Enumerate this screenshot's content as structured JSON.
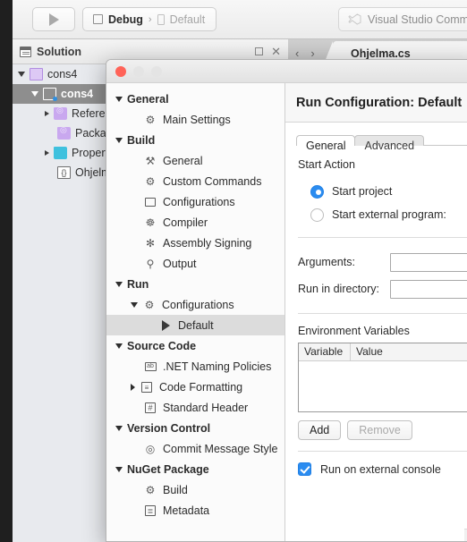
{
  "toolbar": {
    "run_button_icon": "play-triangle-icon",
    "configuration_icon": "square-icon",
    "configuration": "Debug",
    "separator": "›",
    "runtime_icon": "document-icon",
    "runtime": "Default",
    "status_badge": "Visual Studio Communit"
  },
  "solution_pad": {
    "icon": "solution-pad-icon",
    "title": "Solution",
    "pin_icon": "pin-icon",
    "close_icon": "close-icon",
    "tree": [
      {
        "label": "cons4",
        "indent": 0,
        "arrow": "open",
        "icon": "solution-icon",
        "selected": false
      },
      {
        "label": "cons4",
        "indent": 1,
        "arrow": "open",
        "icon": "project-icon",
        "selected": true
      },
      {
        "label": "References",
        "indent": 2,
        "arrow": "closed",
        "icon": "references-folder-icon",
        "selected": false
      },
      {
        "label": "Packages",
        "indent": 2,
        "arrow": "none",
        "icon": "packages-folder-icon",
        "selected": false
      },
      {
        "label": "Properties",
        "indent": 2,
        "arrow": "closed",
        "icon": "properties-folder-icon",
        "selected": false
      },
      {
        "label": "Ohjelma.cs",
        "indent": 2,
        "arrow": "none",
        "icon": "csharp-file-icon",
        "selected": false
      }
    ]
  },
  "editor": {
    "back_icon": "chevron-left-icon",
    "forward_icon": "chevron-right-icon",
    "tab_label": "Ohjelma.cs"
  },
  "dialog": {
    "traffic_lights": {
      "close": "close-window-button",
      "minimize": "minimize-window-button",
      "zoom": "zoom-window-button"
    },
    "sidebar": [
      {
        "label": "General",
        "level": 0,
        "arrow": "open",
        "icon": "",
        "selected": false
      },
      {
        "label": "Main Settings",
        "level": 1,
        "arrow": "none",
        "icon": "gear-icon",
        "selected": false
      },
      {
        "label": "Build",
        "level": 0,
        "arrow": "open",
        "icon": "",
        "selected": false
      },
      {
        "label": "General",
        "level": 1,
        "arrow": "none",
        "icon": "hammer-icon",
        "selected": false
      },
      {
        "label": "Custom Commands",
        "level": 1,
        "arrow": "none",
        "icon": "gear-icon",
        "selected": false
      },
      {
        "label": "Configurations",
        "level": 1,
        "arrow": "none",
        "icon": "rectangle-icon",
        "selected": false
      },
      {
        "label": "Compiler",
        "level": 1,
        "arrow": "none",
        "icon": "robot-icon",
        "selected": false
      },
      {
        "label": "Assembly Signing",
        "level": 1,
        "arrow": "none",
        "icon": "seal-icon",
        "selected": false
      },
      {
        "label": "Output",
        "level": 1,
        "arrow": "none",
        "icon": "flask-icon",
        "selected": false
      },
      {
        "label": "Run",
        "level": 0,
        "arrow": "open",
        "icon": "",
        "selected": false
      },
      {
        "label": "Configurations",
        "level": 1,
        "arrow": "open",
        "icon": "gear-icon",
        "selected": false
      },
      {
        "label": "Default",
        "level": 2,
        "arrow": "none",
        "icon": "play-icon",
        "selected": true
      },
      {
        "label": "Source Code",
        "level": 0,
        "arrow": "open",
        "icon": "",
        "selected": false
      },
      {
        "label": ".NET Naming Policies",
        "level": 1,
        "arrow": "none",
        "icon": "naming-policies-icon",
        "selected": false
      },
      {
        "label": "Code Formatting",
        "level": 1,
        "arrow": "closed",
        "icon": "code-formatting-icon",
        "selected": false
      },
      {
        "label": "Standard Header",
        "level": 1,
        "arrow": "none",
        "icon": "hash-icon",
        "selected": false
      },
      {
        "label": "Version Control",
        "level": 0,
        "arrow": "open",
        "icon": "",
        "selected": false
      },
      {
        "label": "Commit Message Style",
        "level": 1,
        "arrow": "none",
        "icon": "commit-icon",
        "selected": false
      },
      {
        "label": "NuGet Package",
        "level": 0,
        "arrow": "open",
        "icon": "",
        "selected": false
      },
      {
        "label": "Build",
        "level": 1,
        "arrow": "none",
        "icon": "gear-icon",
        "selected": false
      },
      {
        "label": "Metadata",
        "level": 1,
        "arrow": "none",
        "icon": "metadata-icon",
        "selected": false
      }
    ],
    "title": "Run Configuration: Default",
    "tabs": [
      {
        "label": "General",
        "active": true
      },
      {
        "label": "Advanced",
        "active": false
      }
    ],
    "start_action": {
      "label": "Start Action",
      "options": [
        {
          "label": "Start project",
          "selected": true
        },
        {
          "label": "Start external program:",
          "selected": false
        }
      ]
    },
    "fields": [
      {
        "label": "Arguments:",
        "value": "",
        "placeholder": ""
      },
      {
        "label": "Run in directory:",
        "value": "",
        "placeholder": ""
      }
    ],
    "env_vars": {
      "label": "Environment Variables",
      "columns": [
        "Variable",
        "Value"
      ],
      "rows": []
    },
    "buttons": [
      {
        "label": "Add",
        "enabled": true
      },
      {
        "label": "Remove",
        "enabled": false
      }
    ],
    "external_console": {
      "label": "Run on external console",
      "checked": true
    }
  },
  "colors": {
    "accent": "#2b8cf0",
    "traffic_red": "#ff6358",
    "selection_gray": "#8e8e8e",
    "sidebar_selection": "#dcdcdc"
  }
}
